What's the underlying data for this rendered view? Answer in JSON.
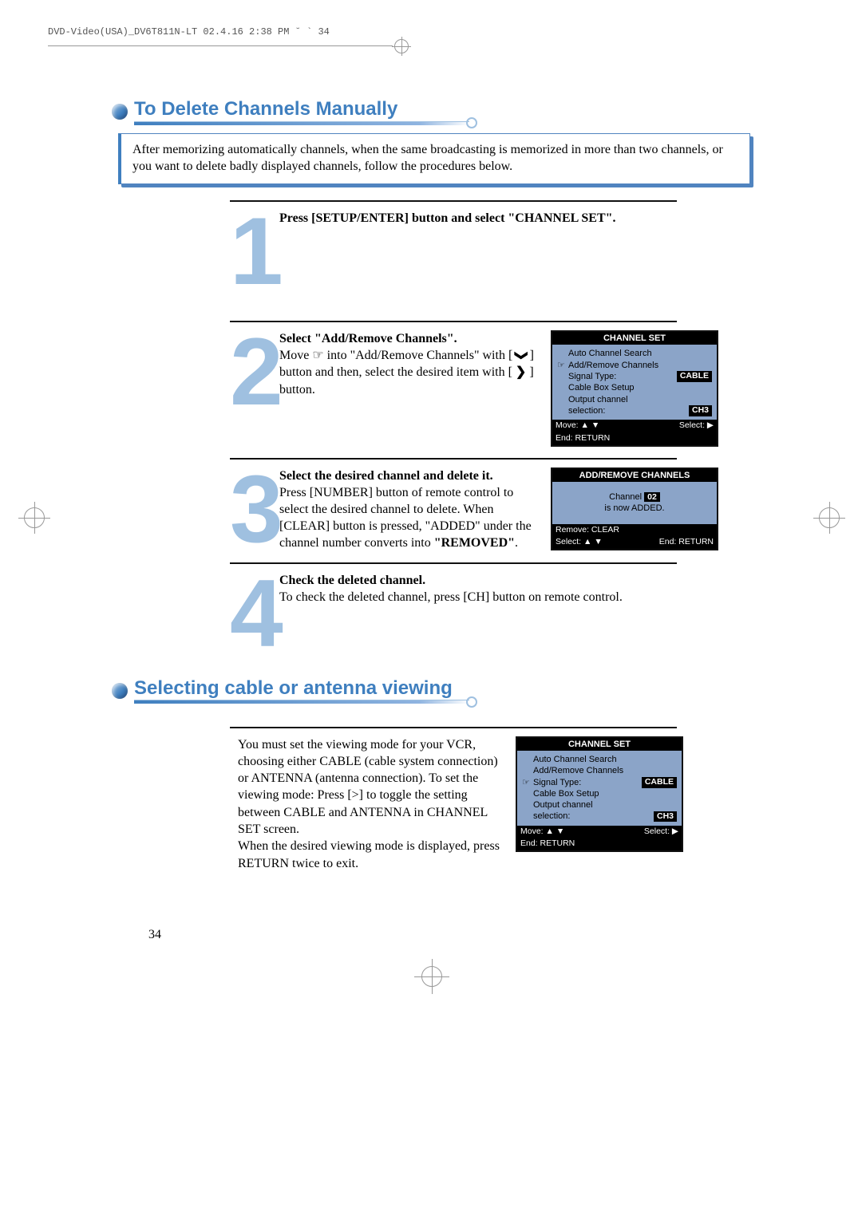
{
  "header_info": "DVD-Video(USA)_DV6T811N-LT  02.4.16 2:38 PM  ˘  `  34",
  "section1": {
    "title": "To Delete Channels Manually",
    "intro": "After memorizing automatically channels, when the same broadcasting is memorized in more than two channels,  or you want to delete badly displayed channels, follow the procedures below."
  },
  "steps": {
    "s1": {
      "num": "1",
      "title": "Press [SETUP/ENTER] button and select \"CHANNEL SET\"."
    },
    "s2": {
      "num": "2",
      "title": "Select \"Add/Remove Channels\".",
      "body_pre": "Move ☞  into \"Add/Remove Channels\" with [ ",
      "body_mid": " ]  button and then, select the desired item with [ ",
      "body_post": " ] button.",
      "icon_v": "❯",
      "icon_r": "❯"
    },
    "s3": {
      "num": "3",
      "title": "Select the desired channel and delete it.",
      "body1": "Press [NUMBER] button of remote control to select the desired channel to delete. When [CLEAR] button is pressed, \"ADDED\" under the channel number converts into ",
      "removed": "\"REMOVED\"",
      "body_end": "."
    },
    "s4": {
      "num": "4",
      "title": "Check the deleted channel.",
      "body": "To check the deleted channel, press [CH] button on remote control."
    }
  },
  "screen_channel_set": {
    "titlebar": "CHANNEL SET",
    "items": [
      "Auto Channel Search",
      "Add/Remove Channels",
      "Signal Type:",
      "Cable Box Setup",
      "Output channel",
      "selection:"
    ],
    "val_signal": "CABLE",
    "val_sel": "CH3",
    "footer_left1": "Move: ▲ ▼",
    "footer_right1": "Select: ▶",
    "footer_left2": "End: RETURN"
  },
  "screen_addremove": {
    "titlebar": "ADD/REMOVE CHANNELS",
    "line1a": "Channel ",
    "line1b": "02",
    "line2": "is now ADDED.",
    "footer_left1": "Remove: CLEAR",
    "footer_left2": "Select: ▲ ▼",
    "footer_right2": "End: RETURN"
  },
  "section2": {
    "title": "Selecting cable or antenna viewing",
    "body": "You must set the viewing mode for your VCR, choosing either CABLE (cable system connection) or ANTENNA (antenna connection). To set the viewing mode: Press [>]  to toggle the setting between CABLE and ANTENNA  in CHANNEL SET screen.\nWhen the desired viewing mode is displayed, press RETURN twice to exit."
  },
  "screen_channel_set2": {
    "titlebar": "CHANNEL SET",
    "items": [
      "Auto Channel Search",
      "Add/Remove Channels",
      "Signal Type:",
      "Cable Box Setup",
      "Output channel",
      "selection:"
    ],
    "val_signal": "CABLE",
    "val_sel": "CH3",
    "footer_left1": "Move: ▲ ▼",
    "footer_right1": "Select: ▶",
    "footer_left2": "End: RETURN"
  },
  "page_number": "34"
}
